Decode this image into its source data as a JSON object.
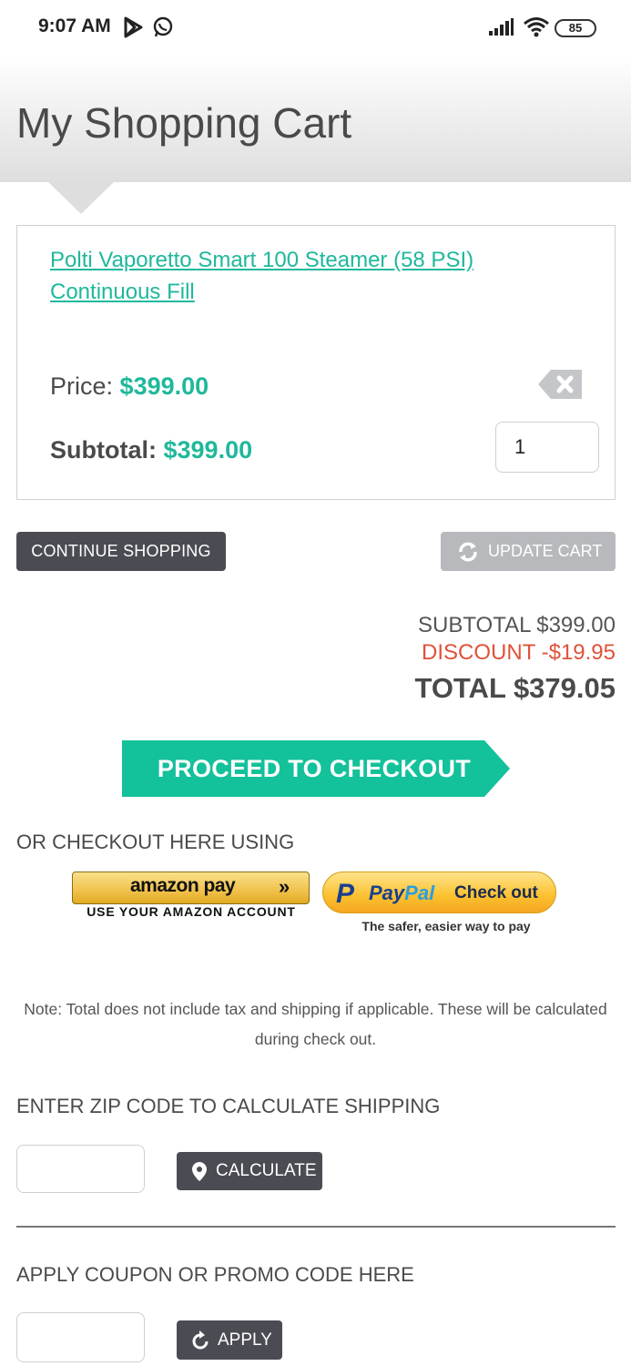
{
  "status_bar": {
    "time": "9:07 AM",
    "battery": "85",
    "icons": [
      "play-store-icon",
      "whatsapp-icon",
      "signal-icon",
      "wifi-icon",
      "battery-icon"
    ]
  },
  "header": {
    "title": "My Shopping Cart",
    "background_color": "#dedede"
  },
  "cart": {
    "items": [
      {
        "name": "Polti Vaporetto Smart 100 Steamer (58 PSI) Continuous Fill",
        "price_label": "Price:",
        "price": "$399.00",
        "subtotal_label": "Subtotal:",
        "subtotal": "$399.00",
        "quantity": "1"
      }
    ],
    "accent_color": "#1fb89b"
  },
  "actions": {
    "continue_label": "CONTINUE SHOPPING",
    "update_label": "UPDATE CART"
  },
  "totals": {
    "subtotal": "SUBTOTAL $399.00",
    "discount": "DISCOUNT -$19.95",
    "total": "TOTAL $379.05",
    "discount_color": "#e0523a"
  },
  "checkout": {
    "proceed_label": "PROCEED TO CHECKOUT",
    "proceed_color": "#13c19a",
    "alt_label": "OR CHECKOUT HERE USING",
    "amazon": {
      "logo_text": "amazon pay",
      "arrows": "»",
      "sub": "USE YOUR AMAZON ACCOUNT"
    },
    "paypal": {
      "pay": "Pay",
      "pal": "Pal",
      "check_out": "Check out",
      "sub": "The safer, easier way to pay"
    }
  },
  "note": "Note: Total does not include tax and shipping if applicable. These will be calculated during check out.",
  "shipping": {
    "label": "ENTER ZIP CODE TO CALCULATE SHIPPING",
    "zip_value": "",
    "button_label": "CALCULATE"
  },
  "coupon": {
    "label": "APPLY COUPON OR PROMO CODE HERE",
    "code_value": "",
    "button_label": "APPLY"
  }
}
